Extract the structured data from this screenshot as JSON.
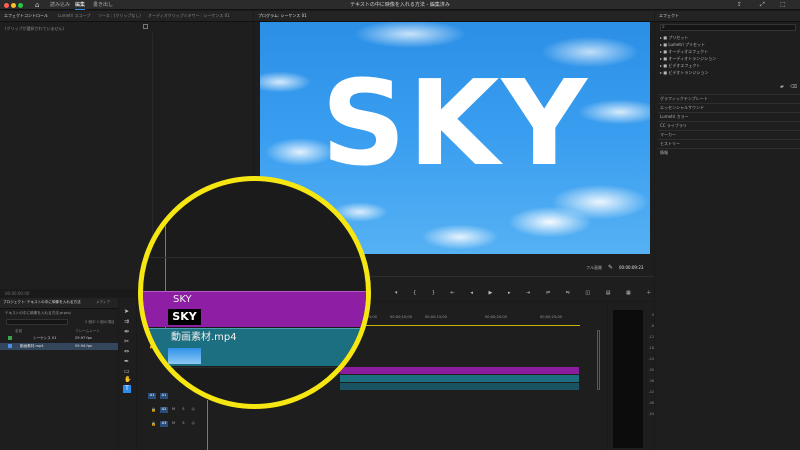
{
  "window": {
    "title": "テキストの中に映像を入れる方法 - 編集済み",
    "tabs": [
      "読み込み",
      "編集",
      "書き出し"
    ]
  },
  "left_panel": {
    "tabs": [
      "エフェクトコントロール",
      "Lumetri スコープ",
      "ソース : (クリップなし)",
      "オーディオクリップミキサー : シーケンス 01"
    ],
    "empty_message": "(クリップが選択されていません)",
    "timecode": "00:00:00:00"
  },
  "program": {
    "tab": "プログラム: シーケンス 01",
    "overlay_text": "SKY",
    "fit": "フル画質",
    "timecode": "00:00:09:23"
  },
  "effects": {
    "tab": "エフェクト",
    "tree": [
      "プリセット",
      "Lumetri プリセット",
      "オーディオエフェクト",
      "オーディオトランジション",
      "ビデオエフェクト",
      "ビデオトランジション"
    ],
    "sections": [
      "グラフィックテンプレート",
      "エッセンシャルサウンド",
      "Lumetri カラー",
      "CC ライブラリ",
      "マーカー",
      "ヒストリー",
      "情報"
    ]
  },
  "project": {
    "tab": "プロジェクト: テキストの中に映像を入れる方法",
    "tab2": "メディア",
    "file": "テキストの中に映像を入れる方法.prproj",
    "count": "2 個中 1 個の項目",
    "columns": [
      "名前",
      "フレームレート"
    ],
    "rows": [
      {
        "name": "シーケンス 01",
        "rate": "29.97 fps"
      },
      {
        "name": "動画素材.mp4",
        "rate": "59.94 fps"
      }
    ]
  },
  "timeline": {
    "ruler_labels": [
      "00;00;05;00",
      "00;00;10;00",
      "00;00;15;00",
      "00;00;20;00",
      "00;00;25;00"
    ],
    "track_labels": [
      "V3",
      "V2",
      "V1",
      "A1",
      "A2",
      "A3"
    ]
  },
  "zoom": {
    "title_clip": "SKY",
    "video_clip": "動画素材.mp4",
    "thumb_text": "SKY"
  },
  "meter_labels": [
    "0",
    "-6",
    "-12",
    "-18",
    "-24",
    "-30",
    "-36",
    "-42",
    "-48",
    "-54"
  ],
  "colors": {
    "highlight": "#f6e712",
    "title_clip": "#8b1c9e",
    "video_clip": "#1c6f7f",
    "accent": "#2d8ceb"
  }
}
